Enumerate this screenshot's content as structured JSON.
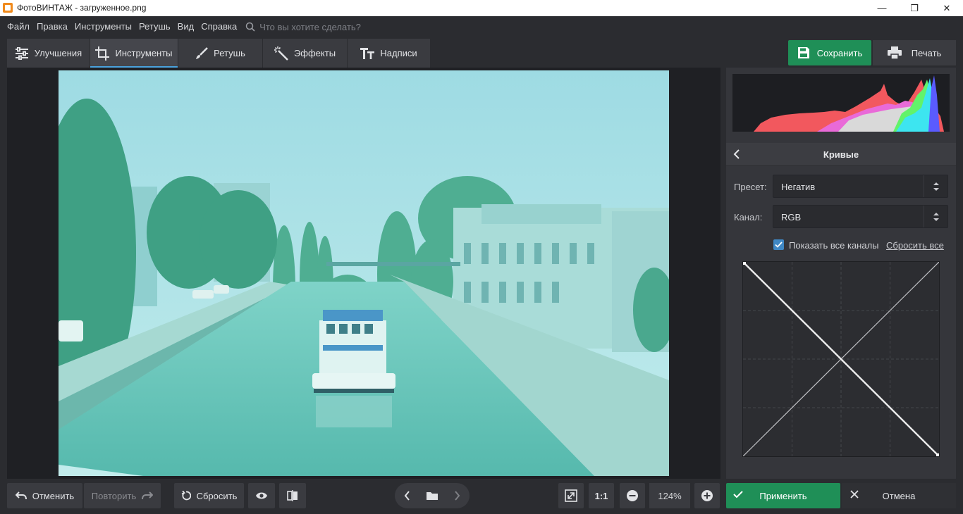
{
  "window": {
    "title": "ФотоВИНТАЖ - загруженное.png"
  },
  "menu": {
    "items": [
      "Файл",
      "Правка",
      "Инструменты",
      "Ретушь",
      "Вид",
      "Справка"
    ],
    "search_placeholder": "Что вы хотите сделать?"
  },
  "tabs": [
    {
      "label": "Улучшения",
      "icon": "sliders-icon"
    },
    {
      "label": "Инструменты",
      "icon": "crop-icon",
      "active": true
    },
    {
      "label": "Ретушь",
      "icon": "brush-icon"
    },
    {
      "label": "Эффекты",
      "icon": "magic-wand-icon"
    },
    {
      "label": "Надписи",
      "icon": "text-icon"
    }
  ],
  "toolbar": {
    "save_label": "Сохранить",
    "print_label": "Печать"
  },
  "curves": {
    "title": "Кривые",
    "preset_label": "Пресет:",
    "preset_value": "Негатив",
    "channel_label": "Канал:",
    "channel_value": "RGB",
    "show_all_channels_label": "Показать все каналы",
    "show_all_channels_checked": true,
    "reset_all_label": "Сбросить все"
  },
  "bottom": {
    "undo_label": "Отменить",
    "redo_label": "Повторить",
    "reset_label": "Сбросить",
    "fit_label": "1:1",
    "zoom_value": "124%",
    "apply_label": "Применить",
    "cancel_label": "Отмена"
  },
  "colors": {
    "accent_green": "#1f8f57",
    "accent_blue": "#4aa3df",
    "photo_tint": "#8fd3d3"
  }
}
